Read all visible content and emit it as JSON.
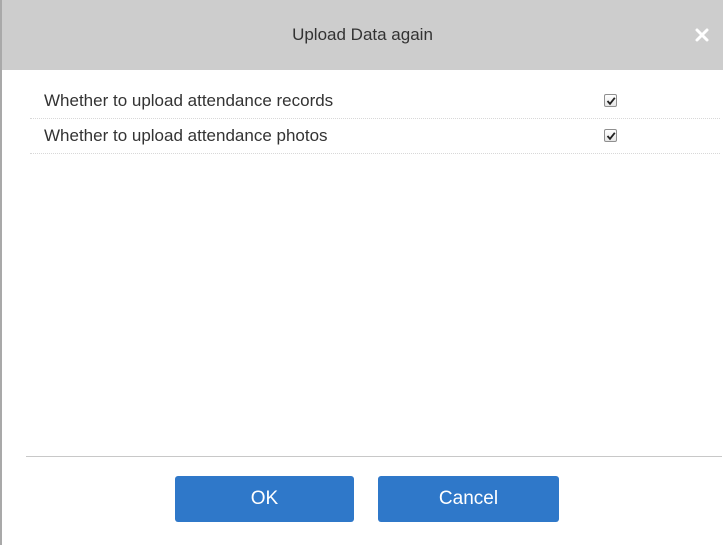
{
  "dialog": {
    "title": "Upload Data again",
    "close_icon": "close-icon"
  },
  "options": [
    {
      "label": "Whether to upload attendance records",
      "checked": true
    },
    {
      "label": "Whether to upload attendance photos",
      "checked": true
    }
  ],
  "buttons": {
    "ok_label": "OK",
    "cancel_label": "Cancel"
  },
  "colors": {
    "titlebar": "#cdcdcd",
    "button": "#2f78c9"
  }
}
